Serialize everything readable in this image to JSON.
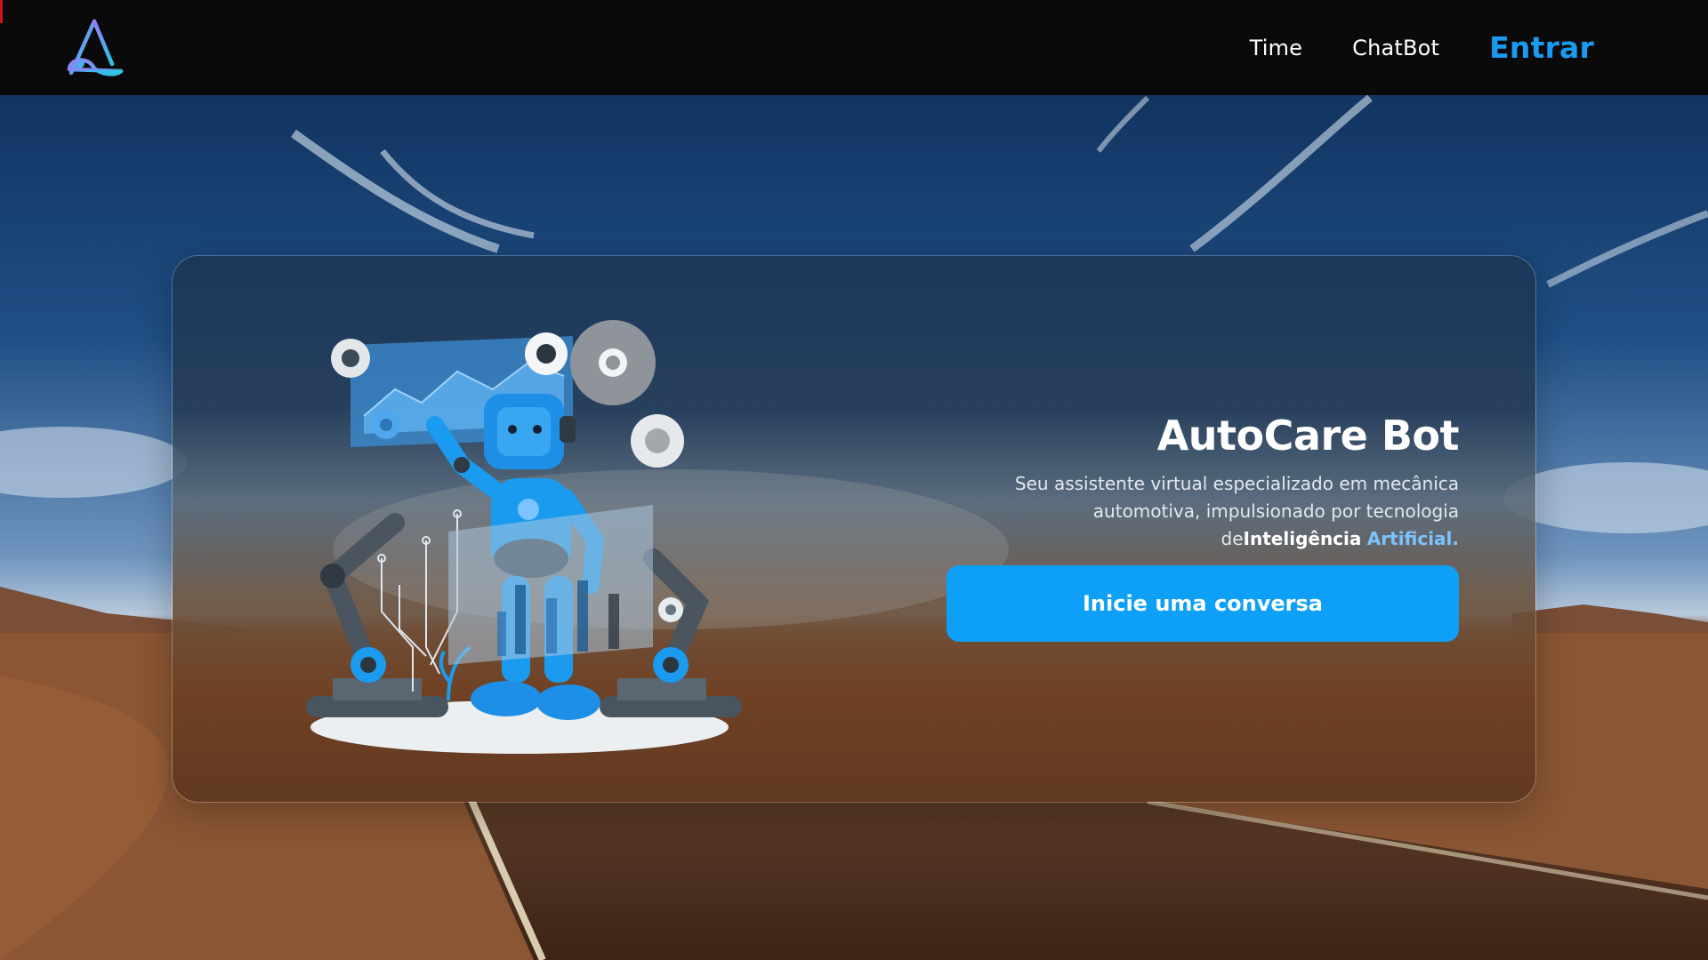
{
  "header": {
    "logo_icon": "autocare-logo-icon",
    "nav": [
      {
        "label": "Time"
      },
      {
        "label": "ChatBot"
      },
      {
        "label": "Entrar"
      }
    ]
  },
  "hero": {
    "title": "AutoCare Bot",
    "description_line1": "Seu assistente virtual especializado em mecânica",
    "description_line2": "automotiva, impulsionado por tecnologia",
    "description_prefix": "de",
    "description_highlight_1": "Inteligência",
    "description_highlight_2": "Artificial.",
    "cta_label": "Inicie uma conversa",
    "illustration": "robot-with-gears-and-charts-illustration"
  },
  "colors": {
    "topbar": "#0a0a0a",
    "accent": "#1a9bf0",
    "button": "#0ea0f7",
    "highlight": "#7cc4ff"
  }
}
